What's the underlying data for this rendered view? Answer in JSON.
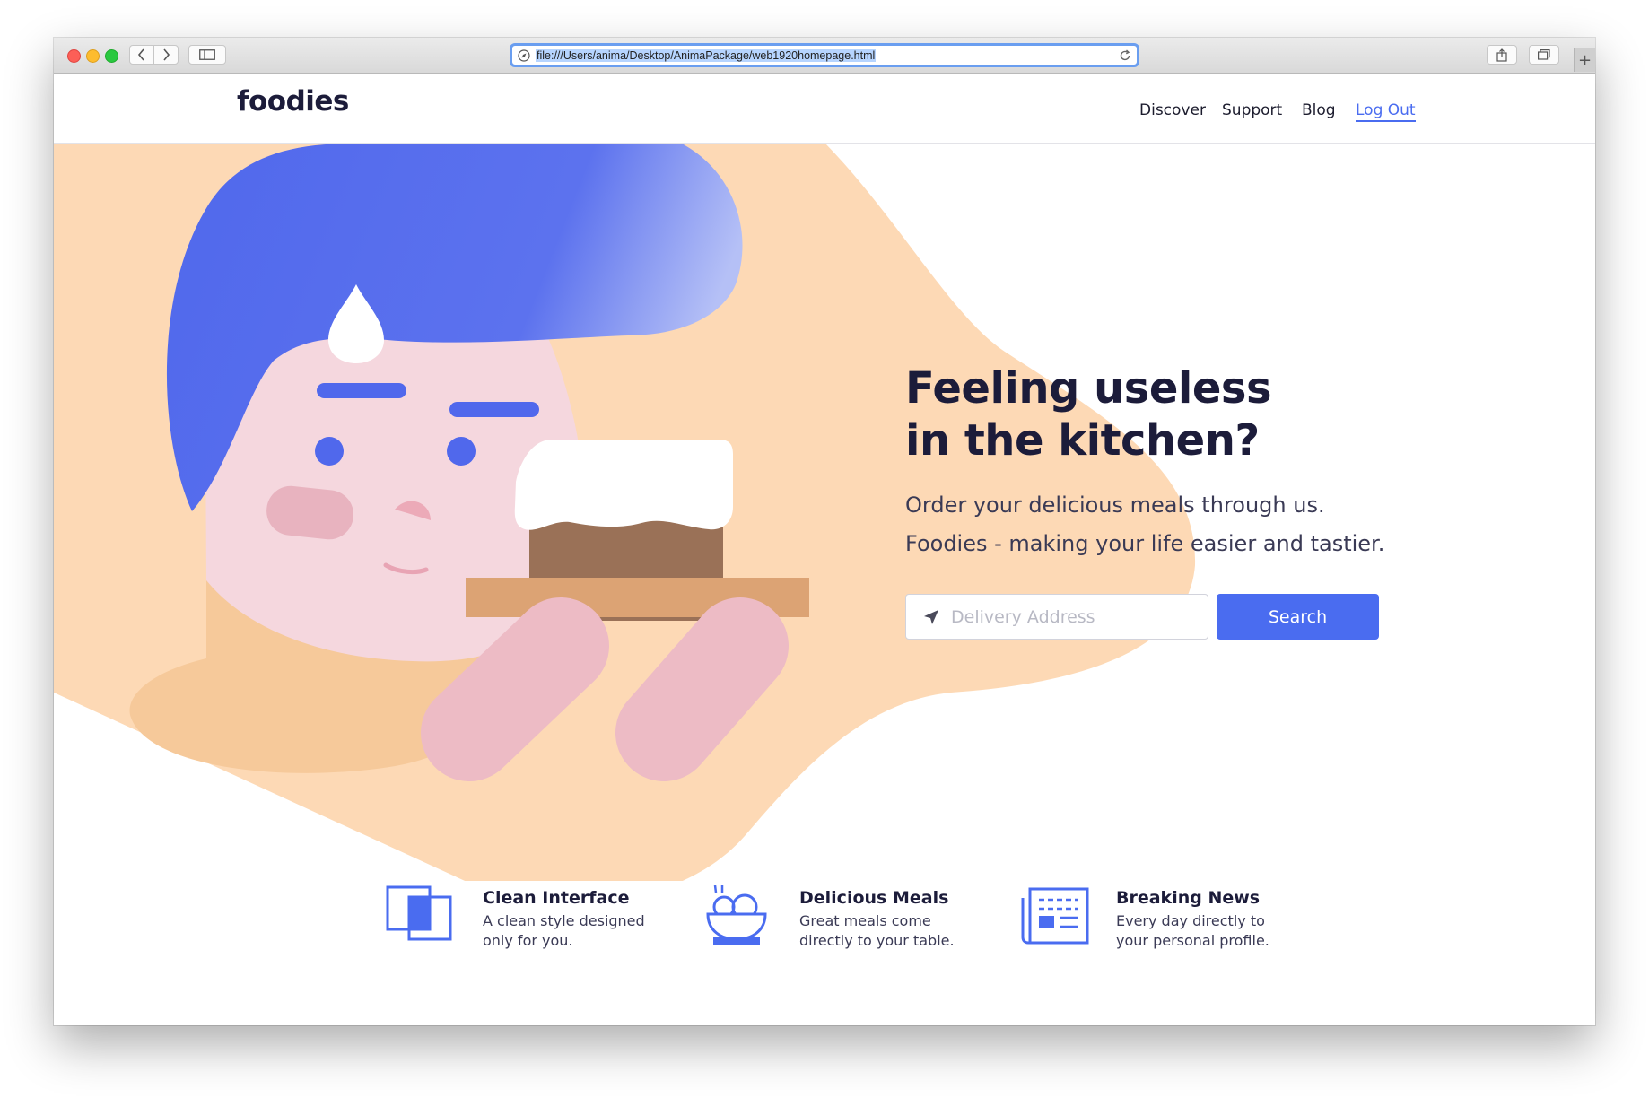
{
  "browser": {
    "url": "file:///Users/anima/Desktop/AnimaPackage/web1920homepage.html",
    "icons": [
      "back-icon",
      "forward-icon",
      "sidebar-icon",
      "compass-icon",
      "reload-icon",
      "share-icon",
      "tabs-icon",
      "plus-icon"
    ]
  },
  "header": {
    "logo": "foodies",
    "nav": [
      "Discover",
      "Support",
      "Blog",
      "Log Out"
    ],
    "active": "Log Out"
  },
  "hero": {
    "headline": "Feeling useless in the kitchen?",
    "subtitle_line1": "Order your delicious meals through us.",
    "subtitle_line2": "Foodies - making your life easier and tastier.",
    "address_placeholder": "Delivery Address",
    "search_label": "Search"
  },
  "features": [
    {
      "title": "Clean Interface",
      "desc": "A clean style designed only for you.",
      "icon": "layers-icon"
    },
    {
      "title": "Delicious Meals",
      "desc": "Great meals come directly to your table.",
      "icon": "bowl-icon"
    },
    {
      "title": "Breaking News",
      "desc": "Every day directly to your personal profile.",
      "icon": "newspaper-icon"
    }
  ],
  "colors": {
    "accent": "#4a6cf0",
    "text_dark": "#1c1c3a",
    "peach": "#fdd9b5",
    "face": "#f5d6dd",
    "hair": "#5b73ee"
  }
}
